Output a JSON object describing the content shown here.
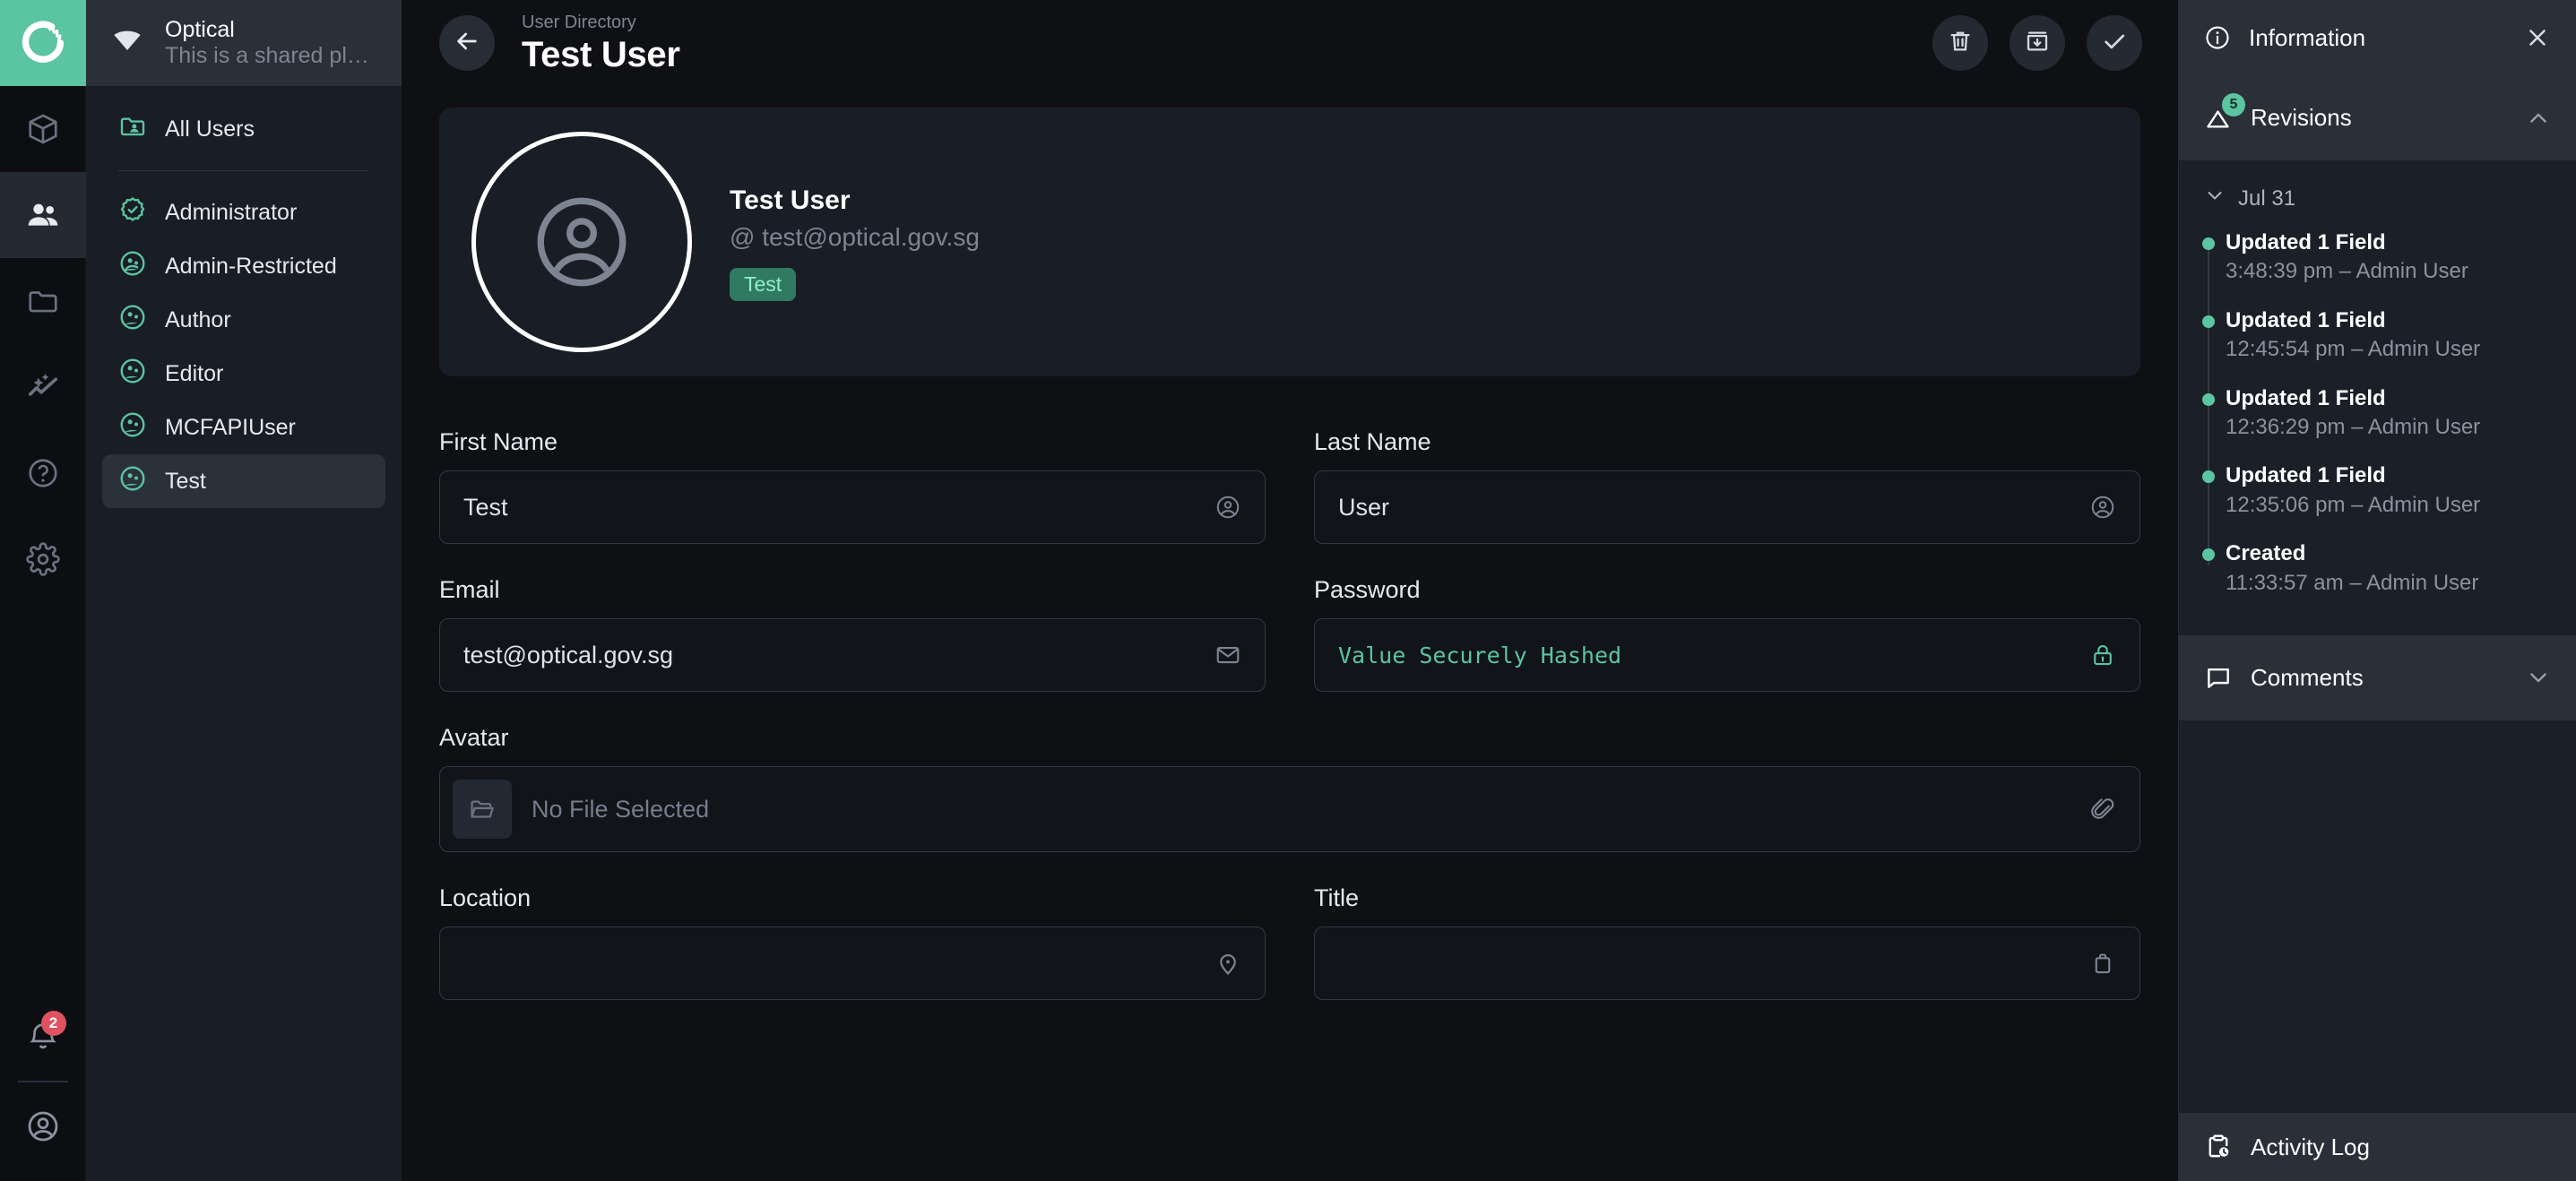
{
  "rail": {
    "logo_icon": "app-logo-icon",
    "items": [
      {
        "icon": "cube-icon",
        "name": "models",
        "active": false
      },
      {
        "icon": "users-icon",
        "name": "users",
        "active": true
      },
      {
        "icon": "folder-icon",
        "name": "files",
        "active": false
      },
      {
        "icon": "insights-icon",
        "name": "insights",
        "active": false
      },
      {
        "icon": "help-circle-icon",
        "name": "help",
        "active": false
      },
      {
        "icon": "gear-icon",
        "name": "settings",
        "active": false
      }
    ],
    "notifications_count": "2",
    "account_icon": "user-circle-icon"
  },
  "nav": {
    "project_title": "Optical",
    "project_subtitle": "This is a shared playgr...",
    "project_icon": "drop-icon",
    "all_users_label": "All Users",
    "all_users_icon": "folder-user-icon",
    "items": [
      {
        "label": "Administrator",
        "icon": "badge-check-icon"
      },
      {
        "label": "Admin-Restricted",
        "icon": "user-role-icon"
      },
      {
        "label": "Author",
        "icon": "user-role-icon"
      },
      {
        "label": "Editor",
        "icon": "user-role-icon"
      },
      {
        "label": "MCFAPIUser",
        "icon": "user-role-icon"
      },
      {
        "label": "Test",
        "icon": "user-role-icon"
      }
    ],
    "selected_index": 5
  },
  "header": {
    "back_icon": "arrow-left-icon",
    "breadcrumb": "User Directory",
    "title": "Test User",
    "actions": [
      {
        "name": "delete-button",
        "icon": "trash-icon"
      },
      {
        "name": "archive-button",
        "icon": "archive-down-icon"
      },
      {
        "name": "save-button",
        "icon": "check-icon"
      }
    ]
  },
  "profile": {
    "avatar_icon": "user-circle-icon",
    "name": "Test User",
    "handle": "@ test@optical.gov.sg",
    "badge": "Test"
  },
  "fields": {
    "first_name": {
      "label": "First Name",
      "value": "Test",
      "icon": "user-icon"
    },
    "last_name": {
      "label": "Last Name",
      "value": "User",
      "icon": "user-icon"
    },
    "email": {
      "label": "Email",
      "value": "test@optical.gov.sg",
      "icon": "mail-icon"
    },
    "password": {
      "label": "Password",
      "value": "Value Securely Hashed",
      "icon": "lock-icon"
    },
    "avatar": {
      "label": "Avatar",
      "placeholder": "No File Selected",
      "thumb_icon": "folder-open-icon",
      "icon": "paperclip-icon"
    },
    "location": {
      "label": "Location",
      "value": "",
      "icon": "map-pin-icon"
    },
    "title": {
      "label": "Title",
      "value": "",
      "icon": "briefcase-icon"
    }
  },
  "panel": {
    "header_title": "Information",
    "header_icon": "info-icon",
    "close_icon": "close-icon",
    "revisions": {
      "title": "Revisions",
      "icon": "revisions-icon",
      "badge": "5",
      "chevron": "chevron-up-icon",
      "date_group": "Jul 31",
      "date_chevron": "chevron-down-icon",
      "items": [
        {
          "title": "Updated 1 Field",
          "meta": "3:48:39 pm – Admin User"
        },
        {
          "title": "Updated 1 Field",
          "meta": "12:45:54 pm – Admin User"
        },
        {
          "title": "Updated 1 Field",
          "meta": "12:36:29 pm – Admin User"
        },
        {
          "title": "Updated 1 Field",
          "meta": "12:35:06 pm – Admin User"
        },
        {
          "title": "Created",
          "meta": "11:33:57 am – Admin User"
        }
      ]
    },
    "comments": {
      "title": "Comments",
      "icon": "comment-icon",
      "chevron": "chevron-down-icon"
    },
    "activity_log": {
      "title": "Activity Log",
      "icon": "clipboard-clock-icon"
    }
  },
  "colors": {
    "accent": "#5bc4a0",
    "danger": "#e05260",
    "bg": "#0e1014",
    "panel_bg": "#1b1f27"
  }
}
